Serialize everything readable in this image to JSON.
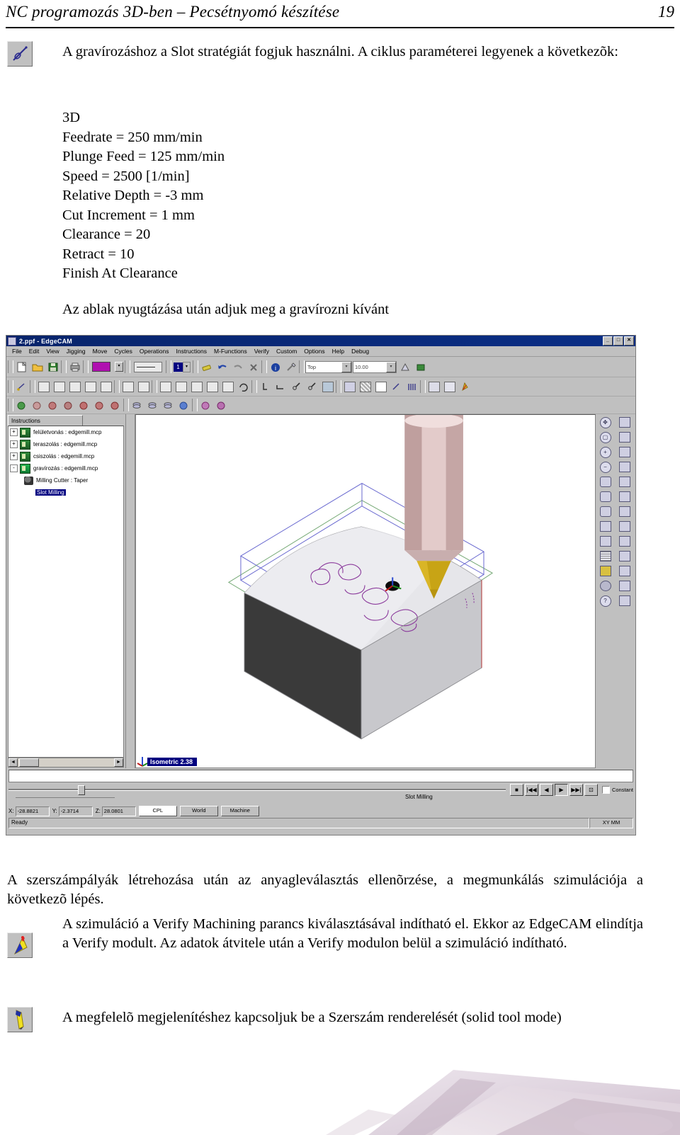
{
  "page": {
    "header_title": "NC programozás 3D-ben – Pecsétnyomó készítése",
    "page_number": "19"
  },
  "intro": {
    "icon": "slot-strategy-icon",
    "text": "A gravírozáshoz a Slot stratégiát fogjuk használni. A ciklus paraméterei legyenek a következõk:",
    "params": "3D\nFeedrate = 250 mm/min\nPlunge Feed = 125 mm/min\nSpeed = 2500 [1/min]\nRelative Depth = -3 mm\nCut Increment = 1 mm\nClearance = 20\nRetract = 10\nFinish At Clearance",
    "after_text": "Az ablak nyugtázása után adjuk meg a gravírozni kívánt"
  },
  "app": {
    "title": "2.ppf - EdgeCAM",
    "window_buttons": [
      "_",
      "□",
      "✕"
    ],
    "menu": [
      "File",
      "Edit",
      "View",
      "Jigging",
      "Move",
      "Cycles",
      "Operations",
      "Instructions",
      "M-Functions",
      "Verify",
      "Custom",
      "Options",
      "Help",
      "Debug"
    ],
    "toolbar1": {
      "combo1_value": "Top",
      "combo2_value": "10.00"
    },
    "tree": {
      "tab_label": "Instructions",
      "items": [
        {
          "expander": "+",
          "label": "felületvonás : edgemill.mcp",
          "type": "operation"
        },
        {
          "expander": "+",
          "label": "teraszolás : edgemill.mcp",
          "type": "operation"
        },
        {
          "expander": "+",
          "label": "csiszolás : edgemill.mcp",
          "type": "operation"
        },
        {
          "expander": "-",
          "label": "gravírozás : edgemill.mcp",
          "type": "operation",
          "selected": true
        },
        {
          "expander": "",
          "label": "Milling Cutter : Taper",
          "type": "tool"
        },
        {
          "expander": "",
          "label": "Slot Milling",
          "type": "cycle",
          "highlighted": true
        }
      ]
    },
    "view": {
      "label": "Isometric 2.38"
    },
    "playback": {
      "buttons": [
        "■",
        "|◀◀",
        "◀",
        "▶",
        "▶▶|",
        "⊡"
      ],
      "constant_label": "Constant",
      "current_cycle": "Slot Milling"
    },
    "status": {
      "x_label": "X:",
      "x_value": "-28.8821",
      "y_label": "Y:",
      "y_value": "-2.3714",
      "z_label": "Z:",
      "z_value": "28.0801",
      "cpl_label": "CPL",
      "world_button": "World",
      "machine_button": "Machine",
      "ready_text": "Ready",
      "units_text": "XY  MM"
    }
  },
  "body": {
    "para1": "A szerszámpályák létrehozása után az anyagleválasztás ellenõrzése, a megmunkálás szimulációja a következõ lépés.",
    "para2_icon": "verify-machining-icon",
    "para2": "A szimuláció a Verify Machining parancs kiválasztásával indítható el. Ekkor az EdgeCAM elindítja a Verify modult. Az adatok átvitele után a Verify modulon belül a szimuláció indítható.",
    "para3_icon": "solid-tool-mode-icon",
    "para3": "A megfelelõ megjelenítéshez kapcsoljuk be a Szerszám renderelését (solid tool mode)"
  },
  "colors": {
    "title_bar": "#08246b",
    "window_face": "#c0c0c0",
    "tool_gold": "#c8a415",
    "tool_body": "#d8bdbc",
    "toolpath": "#8b3a9c",
    "stock_dark": "#3a3a3a",
    "stock_light": "#d9d9dd",
    "boundary_blue": "#6a6ad0",
    "boundary_green": "#74a874"
  }
}
